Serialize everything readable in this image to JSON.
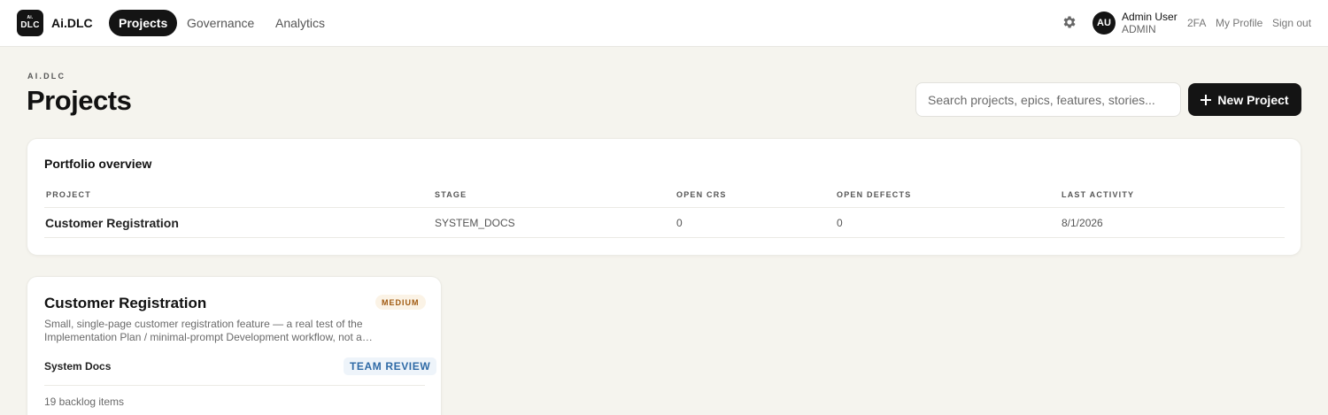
{
  "nav": {
    "logo": {
      "line1": "Ai.",
      "line2": "DLC"
    },
    "brand": "Ai.DLC",
    "tabs": [
      {
        "label": "Projects",
        "active": true
      },
      {
        "label": "Governance",
        "active": false
      },
      {
        "label": "Analytics",
        "active": false
      }
    ],
    "settings_icon": "gear-icon",
    "user": {
      "initials": "AU",
      "name": "Admin User",
      "role": "ADMIN"
    },
    "links": {
      "twofa": "2FA",
      "profile": "My Profile",
      "signout": "Sign out"
    }
  },
  "header": {
    "eyebrow": "AI.DLC",
    "title": "Projects",
    "search_placeholder": "Search projects, epics, features, stories...",
    "new_project_label": "New Project",
    "new_project_icon": "plus-icon"
  },
  "portfolio": {
    "title": "Portfolio overview",
    "columns": [
      "PROJECT",
      "STAGE",
      "OPEN CRS",
      "OPEN DEFECTS",
      "LAST ACTIVITY"
    ],
    "rows": [
      {
        "project": "Customer Registration",
        "stage": "SYSTEM_DOCS",
        "open_crs": "0",
        "open_defects": "0",
        "last_activity": "8/1/2026"
      }
    ]
  },
  "project_card": {
    "title": "Customer Registration",
    "priority": "MEDIUM",
    "description": "Small, single-page customer registration feature — a real test of the Implementation Plan / minimal-prompt Development workflow, not a production…",
    "stage": "System Docs",
    "review_status": "TEAM REVIEW",
    "backlog": "19 backlog items"
  },
  "colors": {
    "page_bg": "#f5f4ee",
    "primary": "#141414",
    "priority_text": "#a05a10",
    "review_text": "#2f6aa6"
  }
}
